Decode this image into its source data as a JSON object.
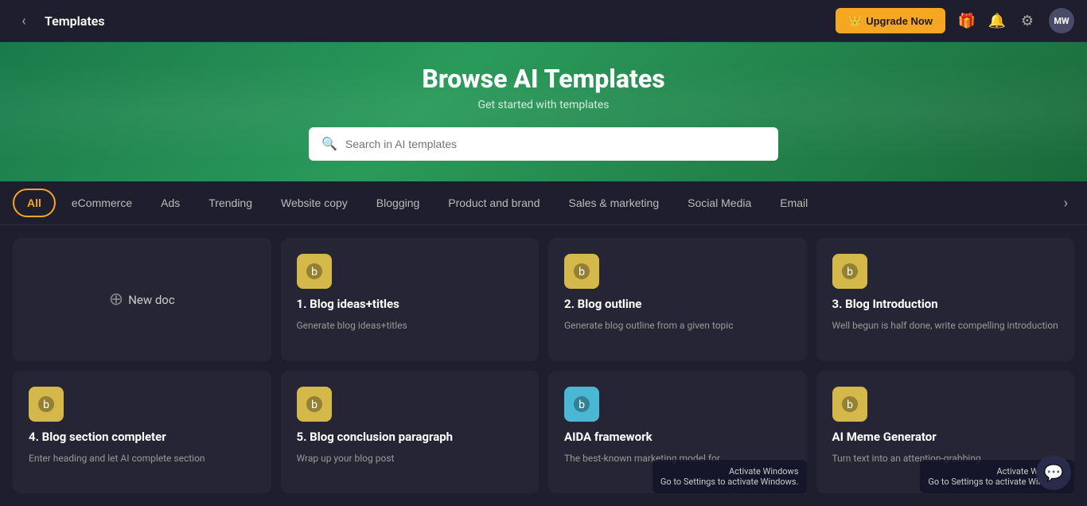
{
  "header": {
    "title": "Templates",
    "back_label": "‹",
    "upgrade_label": "Upgrade Now",
    "upgrade_icon": "👑",
    "gift_icon": "🎁",
    "bell_icon": "🔔",
    "gear_icon": "⚙",
    "avatar_label": "MW"
  },
  "hero": {
    "title": "Browse AI Templates",
    "subtitle": "Get started with templates",
    "search_placeholder": "Search in AI templates"
  },
  "filters": {
    "tabs": [
      {
        "label": "All",
        "active": true
      },
      {
        "label": "eCommerce",
        "active": false
      },
      {
        "label": "Ads",
        "active": false
      },
      {
        "label": "Trending",
        "active": false
      },
      {
        "label": "Website copy",
        "active": false
      },
      {
        "label": "Blogging",
        "active": false
      },
      {
        "label": "Product and brand",
        "active": false
      },
      {
        "label": "Sales & marketing",
        "active": false
      },
      {
        "label": "Social Media",
        "active": false
      },
      {
        "label": "Email",
        "active": false
      }
    ],
    "chevron": "›"
  },
  "cards": [
    {
      "id": "new-doc",
      "type": "new",
      "label": "New doc"
    },
    {
      "id": "blog-ideas",
      "type": "template",
      "icon_type": "yellow",
      "icon_char": "✍",
      "number": "1.",
      "title": "Blog ideas+titles",
      "desc": "Generate blog ideas+titles"
    },
    {
      "id": "blog-outline",
      "type": "template",
      "icon_type": "yellow",
      "icon_char": "✍",
      "number": "2.",
      "title": "Blog outline",
      "desc": "Generate blog outline from a given topic"
    },
    {
      "id": "blog-intro",
      "type": "template",
      "icon_type": "yellow",
      "icon_char": "✍",
      "number": "3.",
      "title": "Blog Introduction",
      "desc": "Well begun is half done, write compelling introduction"
    },
    {
      "id": "blog-section",
      "type": "template",
      "icon_type": "yellow",
      "icon_char": "✍",
      "number": "4.",
      "title": "Blog section completer",
      "desc": "Enter heading and let AI complete section"
    },
    {
      "id": "blog-conclusion",
      "type": "template",
      "icon_type": "yellow",
      "icon_char": "✍",
      "number": "5.",
      "title": "Blog conclusion paragraph",
      "desc": "Wrap up your blog post"
    },
    {
      "id": "aida",
      "type": "template",
      "icon_type": "cyan",
      "icon_char": "✉",
      "number": "",
      "title": "AIDA framework",
      "desc": "The best-known marketing model for"
    },
    {
      "id": "meme",
      "type": "template",
      "icon_type": "yellow",
      "icon_char": "✍",
      "number": "",
      "title": "AI Meme Generator",
      "desc": "Turn text into an attention-grabbing"
    }
  ],
  "activate_windows": {
    "line1": "Activate Windows",
    "line2": "Go to Settings to activate Windows."
  }
}
